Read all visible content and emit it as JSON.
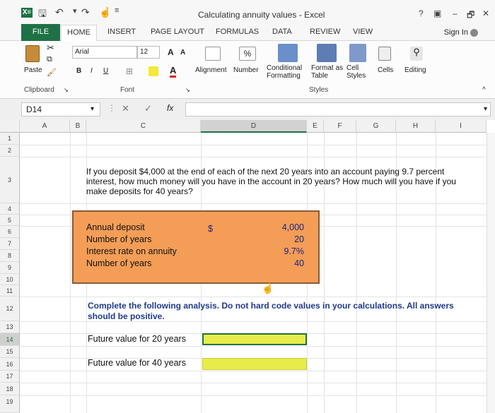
{
  "window": {
    "title": "Calculating annuity values - Excel",
    "help": "?",
    "min": "–",
    "max": "🗗",
    "close": "✕"
  },
  "qat": {
    "app_icon": "X≡",
    "save_icon": "save-icon",
    "undo_icon": "undo-icon",
    "redo_icon": "redo-icon"
  },
  "tabs": [
    "FILE",
    "HOME",
    "INSERT",
    "PAGE LAYOUT",
    "FORMULAS",
    "DATA",
    "REVIEW",
    "VIEW"
  ],
  "sign_in": "Sign In",
  "ribbon": {
    "paste": "Paste",
    "clipboard": "Clipboard",
    "font_name": "Arial",
    "font_size": "12",
    "bold": "B",
    "italic": "I",
    "underline": "U",
    "grow": "A",
    "shrink": "A",
    "font_group": "Font",
    "alignment": "Alignment",
    "number": "Number",
    "percent": "%",
    "cond_fmt": "Conditional Formatting",
    "fmt_table": "Format as Table",
    "cell_styles": "Cell Styles",
    "styles_group": "Styles",
    "cells": "Cells",
    "editing": "Editing"
  },
  "formula_bar": {
    "name_box": "D14",
    "cancel": "✕",
    "enter": "✓",
    "fx": "fx",
    "formula": ""
  },
  "columns": [
    "A",
    "B",
    "C",
    "D",
    "E",
    "F",
    "G",
    "H",
    "I"
  ],
  "rows": [
    "1",
    "2",
    "3",
    "4",
    "5",
    "6",
    "7",
    "8",
    "9",
    "10",
    "11",
    "12",
    "13",
    "14",
    "15",
    "16",
    "17",
    "18",
    "19"
  ],
  "question": "If you deposit $4,000 at the end of each of the next 20 years into an account paying 9.7 percent interest, how much money will you have in the account in 20 years? How much will you have if you make deposits for 40 years?",
  "inputs": {
    "labels": [
      "Annual deposit",
      "Number of years",
      "Interest rate on annuity",
      "Number of years"
    ],
    "values": [
      "4,000",
      "20",
      "9.7%",
      "40"
    ],
    "currency": "$"
  },
  "instruction": "Complete the following analysis. Do not hard code values in your calculations. All answers should be positive.",
  "outputs": {
    "fv20": "Future value for 20 years",
    "fv40": "Future value for 40 years"
  }
}
